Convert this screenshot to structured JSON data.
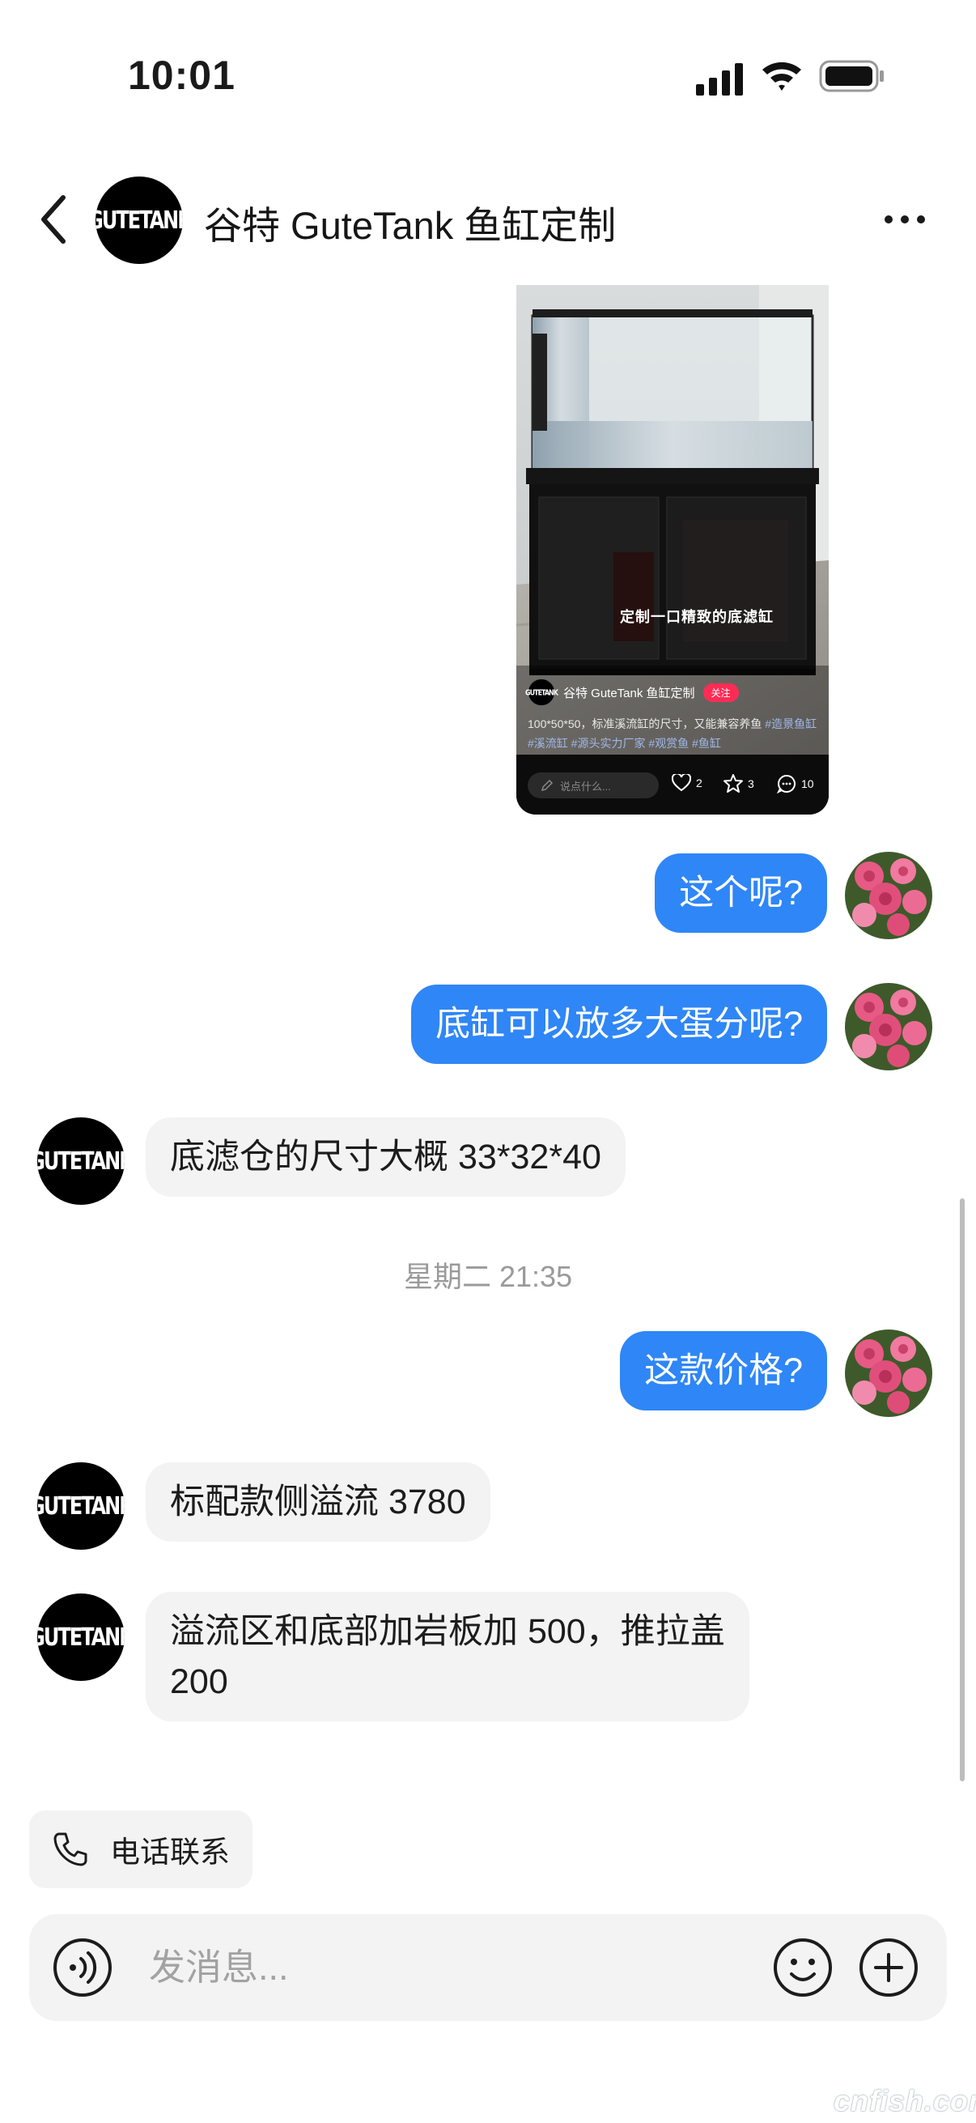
{
  "status_bar": {
    "time": "10:01"
  },
  "header": {
    "title": "谷特 GuteTank 鱼缸定制",
    "logo_text": "GUTETANK"
  },
  "shared_video": {
    "caption": "定制一口精致的底滤缸",
    "author": "谷特 GuteTank 鱼缸定制",
    "follow_label": "关注",
    "description": "100*50*50，标准溪流缸的尺寸，又能兼容养鱼",
    "tags": "#造景鱼缸 #溪流缸 #源头实力厂家 #观赏鱼 #鱼缸",
    "comment_placeholder": "说点什么...",
    "likes": "2",
    "favorites": "3",
    "comments": "10"
  },
  "messages": [
    {
      "sender": "me",
      "text": "这个呢?"
    },
    {
      "sender": "me",
      "text": "底缸可以放多大蛋分呢?"
    },
    {
      "sender": "shop",
      "text": "底滤仓的尺寸大概 33*32*40"
    },
    {
      "sender": "me",
      "text": "这款价格?"
    },
    {
      "sender": "shop",
      "text": "标配款侧溢流 3780"
    },
    {
      "sender": "shop",
      "text_line1": "溢流区和底部加岩板加 500，推拉盖",
      "text_line2": "200"
    }
  ],
  "timestamp": "星期二 21:35",
  "quick_actions": {
    "call_label": "电话联系"
  },
  "composer": {
    "placeholder": "发消息..."
  },
  "watermark": "cnfish.com",
  "colors": {
    "my_bubble": "#2f86f6",
    "their_bubble": "#f3f3f4",
    "follow": "#fe2c55"
  }
}
